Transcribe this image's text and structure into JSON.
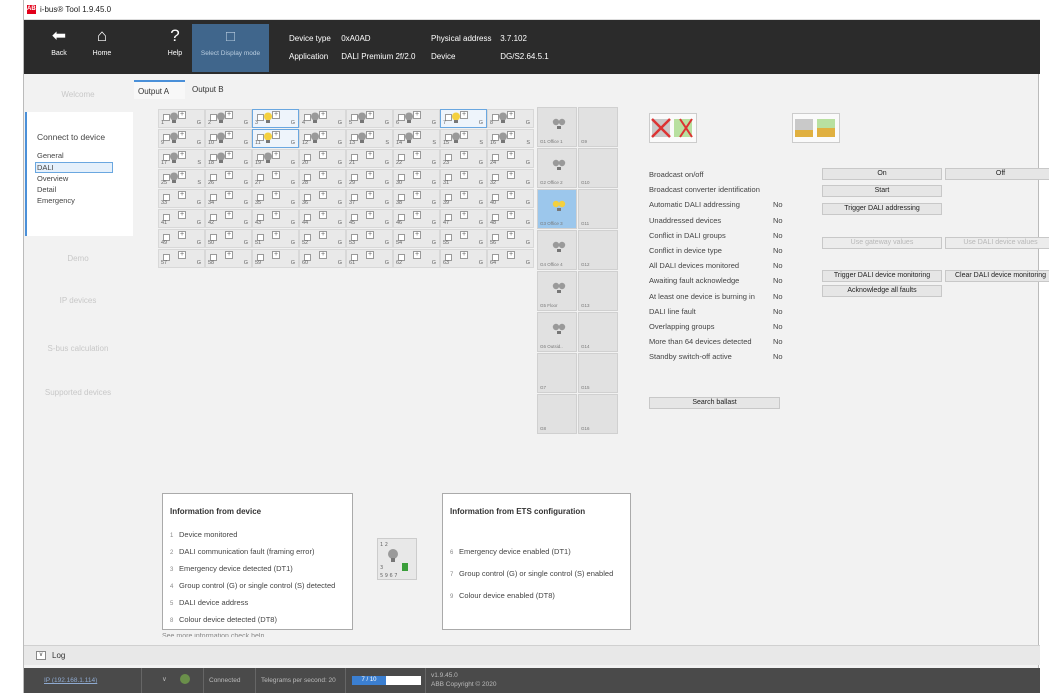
{
  "window": {
    "title": "i-bus® Tool 1.9.45.0",
    "logo_text": "ABB"
  },
  "toolbar": {
    "back_label": "Back",
    "home_label": "Home",
    "help_label": "Help",
    "display_mode_label": "Select Display mode",
    "device_type_key": "Device type",
    "device_type_value": "0xA0AD",
    "application_key": "Application",
    "application_value": "DALI Premium 2f/2.0",
    "physical_address_key": "Physical address",
    "physical_address_value": "3.7.102",
    "device_key": "Device",
    "device_value": "DG/S2.64.5.1"
  },
  "sidebar": {
    "welcome": "Welcome",
    "connect_heading": "Connect to device",
    "connect_items": [
      "General",
      "DALI",
      "Overview",
      "Detail",
      "Emergency"
    ],
    "demo": "Demo",
    "ip_devices": "IP devices",
    "sbus_calculation": "S-bus calculation",
    "supported_devices": "Supported devices"
  },
  "tabs": [
    "Output A",
    "Output B"
  ],
  "grid": {
    "cells": [
      {
        "n": "1",
        "g": "G",
        "bulb": "grey",
        "sel": false
      },
      {
        "n": "2",
        "g": "G",
        "bulb": "grey",
        "sel": false
      },
      {
        "n": "3",
        "g": "G",
        "bulb": "yellow",
        "sel": true
      },
      {
        "n": "4",
        "g": "G",
        "bulb": "grey",
        "sel": false
      },
      {
        "n": "5",
        "g": "G",
        "bulb": "grey",
        "sel": false
      },
      {
        "n": "6",
        "g": "G",
        "bulb": "grey",
        "sel": false
      },
      {
        "n": "7",
        "g": "G",
        "bulb": "yellow",
        "sel": true
      },
      {
        "n": "8",
        "g": "G",
        "bulb": "grey",
        "sel": false
      },
      {
        "n": "9",
        "g": "G",
        "bulb": "grey",
        "sel": false
      },
      {
        "n": "10",
        "g": "G",
        "bulb": "grey",
        "sel": false
      },
      {
        "n": "11",
        "g": "G",
        "bulb": "yellow",
        "sel": true
      },
      {
        "n": "12",
        "g": "G",
        "bulb": "grey",
        "sel": false
      },
      {
        "n": "13",
        "g": "S",
        "bulb": "grey",
        "sel": false
      },
      {
        "n": "14",
        "g": "S",
        "bulb": "grey",
        "sel": false
      },
      {
        "n": "15",
        "g": "S",
        "bulb": "grey",
        "sel": false
      },
      {
        "n": "16",
        "g": "S",
        "bulb": "grey",
        "sel": false
      },
      {
        "n": "17",
        "g": "S",
        "bulb": "grey",
        "sel": false
      },
      {
        "n": "18",
        "g": "G",
        "bulb": "grey",
        "sel": false
      },
      {
        "n": "19",
        "g": "G",
        "bulb": "grey",
        "sel": false
      },
      {
        "n": "20",
        "g": "G",
        "bulb": "none",
        "sel": false
      },
      {
        "n": "21",
        "g": "G",
        "bulb": "none",
        "sel": false
      },
      {
        "n": "22",
        "g": "G",
        "bulb": "none",
        "sel": false
      },
      {
        "n": "23",
        "g": "G",
        "bulb": "none",
        "sel": false
      },
      {
        "n": "24",
        "g": "G",
        "bulb": "none",
        "sel": false
      },
      {
        "n": "25",
        "g": "S",
        "bulb": "grey",
        "sel": false
      },
      {
        "n": "26",
        "g": "G",
        "bulb": "none",
        "sel": false
      },
      {
        "n": "27",
        "g": "G",
        "bulb": "none",
        "sel": false
      },
      {
        "n": "28",
        "g": "G",
        "bulb": "none",
        "sel": false
      },
      {
        "n": "29",
        "g": "G",
        "bulb": "none",
        "sel": false
      },
      {
        "n": "30",
        "g": "G",
        "bulb": "none",
        "sel": false
      },
      {
        "n": "31",
        "g": "G",
        "bulb": "none",
        "sel": false
      },
      {
        "n": "32",
        "g": "G",
        "bulb": "none",
        "sel": false
      },
      {
        "n": "33",
        "g": "G",
        "bulb": "none",
        "sel": false
      },
      {
        "n": "34",
        "g": "G",
        "bulb": "none",
        "sel": false
      },
      {
        "n": "35",
        "g": "G",
        "bulb": "none",
        "sel": false
      },
      {
        "n": "36",
        "g": "G",
        "bulb": "none",
        "sel": false
      },
      {
        "n": "37",
        "g": "G",
        "bulb": "none",
        "sel": false
      },
      {
        "n": "38",
        "g": "G",
        "bulb": "none",
        "sel": false
      },
      {
        "n": "39",
        "g": "G",
        "bulb": "none",
        "sel": false
      },
      {
        "n": "40",
        "g": "G",
        "bulb": "none",
        "sel": false
      },
      {
        "n": "41",
        "g": "G",
        "bulb": "none",
        "sel": false
      },
      {
        "n": "42",
        "g": "G",
        "bulb": "none",
        "sel": false
      },
      {
        "n": "43",
        "g": "G",
        "bulb": "none",
        "sel": false
      },
      {
        "n": "44",
        "g": "G",
        "bulb": "none",
        "sel": false
      },
      {
        "n": "45",
        "g": "G",
        "bulb": "none",
        "sel": false
      },
      {
        "n": "46",
        "g": "G",
        "bulb": "none",
        "sel": false
      },
      {
        "n": "47",
        "g": "G",
        "bulb": "none",
        "sel": false
      },
      {
        "n": "48",
        "g": "G",
        "bulb": "none",
        "sel": false
      },
      {
        "n": "49",
        "g": "G",
        "bulb": "none",
        "sel": false
      },
      {
        "n": "50",
        "g": "G",
        "bulb": "none",
        "sel": false
      },
      {
        "n": "51",
        "g": "G",
        "bulb": "none",
        "sel": false
      },
      {
        "n": "52",
        "g": "G",
        "bulb": "none",
        "sel": false
      },
      {
        "n": "53",
        "g": "G",
        "bulb": "none",
        "sel": false
      },
      {
        "n": "54",
        "g": "G",
        "bulb": "none",
        "sel": false
      },
      {
        "n": "55",
        "g": "G",
        "bulb": "none",
        "sel": false
      },
      {
        "n": "56",
        "g": "G",
        "bulb": "none",
        "sel": false
      },
      {
        "n": "57",
        "g": "G",
        "bulb": "none",
        "sel": false
      },
      {
        "n": "58",
        "g": "G",
        "bulb": "none",
        "sel": false
      },
      {
        "n": "59",
        "g": "G",
        "bulb": "none",
        "sel": false
      },
      {
        "n": "60",
        "g": "G",
        "bulb": "none",
        "sel": false
      },
      {
        "n": "61",
        "g": "G",
        "bulb": "none",
        "sel": false
      },
      {
        "n": "62",
        "g": "G",
        "bulb": "none",
        "sel": false
      },
      {
        "n": "63",
        "g": "G",
        "bulb": "none",
        "sel": false
      },
      {
        "n": "64",
        "g": "G",
        "bulb": "none",
        "sel": false
      }
    ]
  },
  "groups": [
    {
      "a": "G1 Office 1",
      "b": "G9",
      "bulb": "grey",
      "sel": false
    },
    {
      "a": "G2 Office 2",
      "b": "G10",
      "bulb": "grey",
      "sel": false
    },
    {
      "a": "G3 Office 3",
      "b": "G11",
      "bulb": "yellow",
      "sel": true
    },
    {
      "a": "G4 Office 4",
      "b": "G12",
      "bulb": "grey",
      "sel": false
    },
    {
      "a": "G5 Floor",
      "b": "G13",
      "bulb": "grey",
      "sel": false
    },
    {
      "a": "G6 Outsid..",
      "b": "G14",
      "bulb": "grey",
      "sel": false
    },
    {
      "a": "G7",
      "b": "G15",
      "bulb": "none",
      "sel": false
    },
    {
      "a": "G8",
      "b": "G16",
      "bulb": "none",
      "sel": false
    }
  ],
  "status": {
    "rows": [
      {
        "label": "Broadcast on/off",
        "value": ""
      },
      {
        "label": "Broadcast converter identification",
        "value": ""
      },
      {
        "label": "Automatic DALI addressing",
        "value": "No"
      },
      {
        "label": "Unaddressed devices",
        "value": "No"
      },
      {
        "label": "Conflict in DALI groups",
        "value": "No"
      },
      {
        "label": "Conflict in device type",
        "value": "No"
      },
      {
        "label": "All DALI devices monitored",
        "value": "No"
      },
      {
        "label": "Awaiting fault acknowledge",
        "value": "No"
      },
      {
        "label": "At least one device is burning in",
        "value": "No"
      },
      {
        "label": "DALI line fault",
        "value": "No"
      },
      {
        "label": "Overlapping groups",
        "value": "No"
      },
      {
        "label": "More than 64 devices detected",
        "value": "No"
      },
      {
        "label": "Standby switch-off active",
        "value": "No"
      }
    ],
    "btn_on": "On",
    "btn_off": "Off",
    "btn_start": "Start",
    "btn_trigger_addressing": "Trigger DALI addressing",
    "btn_gateway_values": "Use gateway values",
    "btn_device_values": "Use DALI device values",
    "btn_trigger_monitoring": "Trigger DALI device monitoring",
    "btn_clear_monitoring": "Clear DALI device monitoring",
    "btn_ack_faults": "Acknowledge all faults",
    "btn_search_ballast": "Search ballast"
  },
  "info_device": {
    "title": "Information from device",
    "lines": [
      {
        "n": "1",
        "t": "Device monitored"
      },
      {
        "n": "2",
        "t": "DALI communication fault (framing error)"
      },
      {
        "n": "3",
        "t": "Emergency device detected (DT1)"
      },
      {
        "n": "4",
        "t": "Group control (G) or single control (S) detected"
      },
      {
        "n": "5",
        "t": "DALI device address"
      },
      {
        "n": "8",
        "t": "Colour device detected (DT8)"
      }
    ],
    "more": "See more information check help"
  },
  "info_ets": {
    "title": "Information from ETS configuration",
    "lines": [
      {
        "n": "6",
        "t": "Emergency device enabled (DT1)"
      },
      {
        "n": "7",
        "t": "Group control (G) or single control (S) enabled"
      },
      {
        "n": "9",
        "t": "Colour device enabled (DT8)"
      }
    ]
  },
  "log": {
    "toggle": "v",
    "label": "Log"
  },
  "statusbar": {
    "connection": "IP (192.168.1.114)",
    "connected": "Connected",
    "telegrams": "Telegrams per second: 20",
    "progress": "7 / 10",
    "version": "v1.9.45.0",
    "copyright": "ABB Copyright © 2020"
  },
  "colors": {
    "accent": "#4a90d9",
    "toolbar": "#2b2b2b",
    "display_mode": "#40668c",
    "bulb_on": "#f4d03f",
    "bulb_off": "#9a9a9a"
  }
}
